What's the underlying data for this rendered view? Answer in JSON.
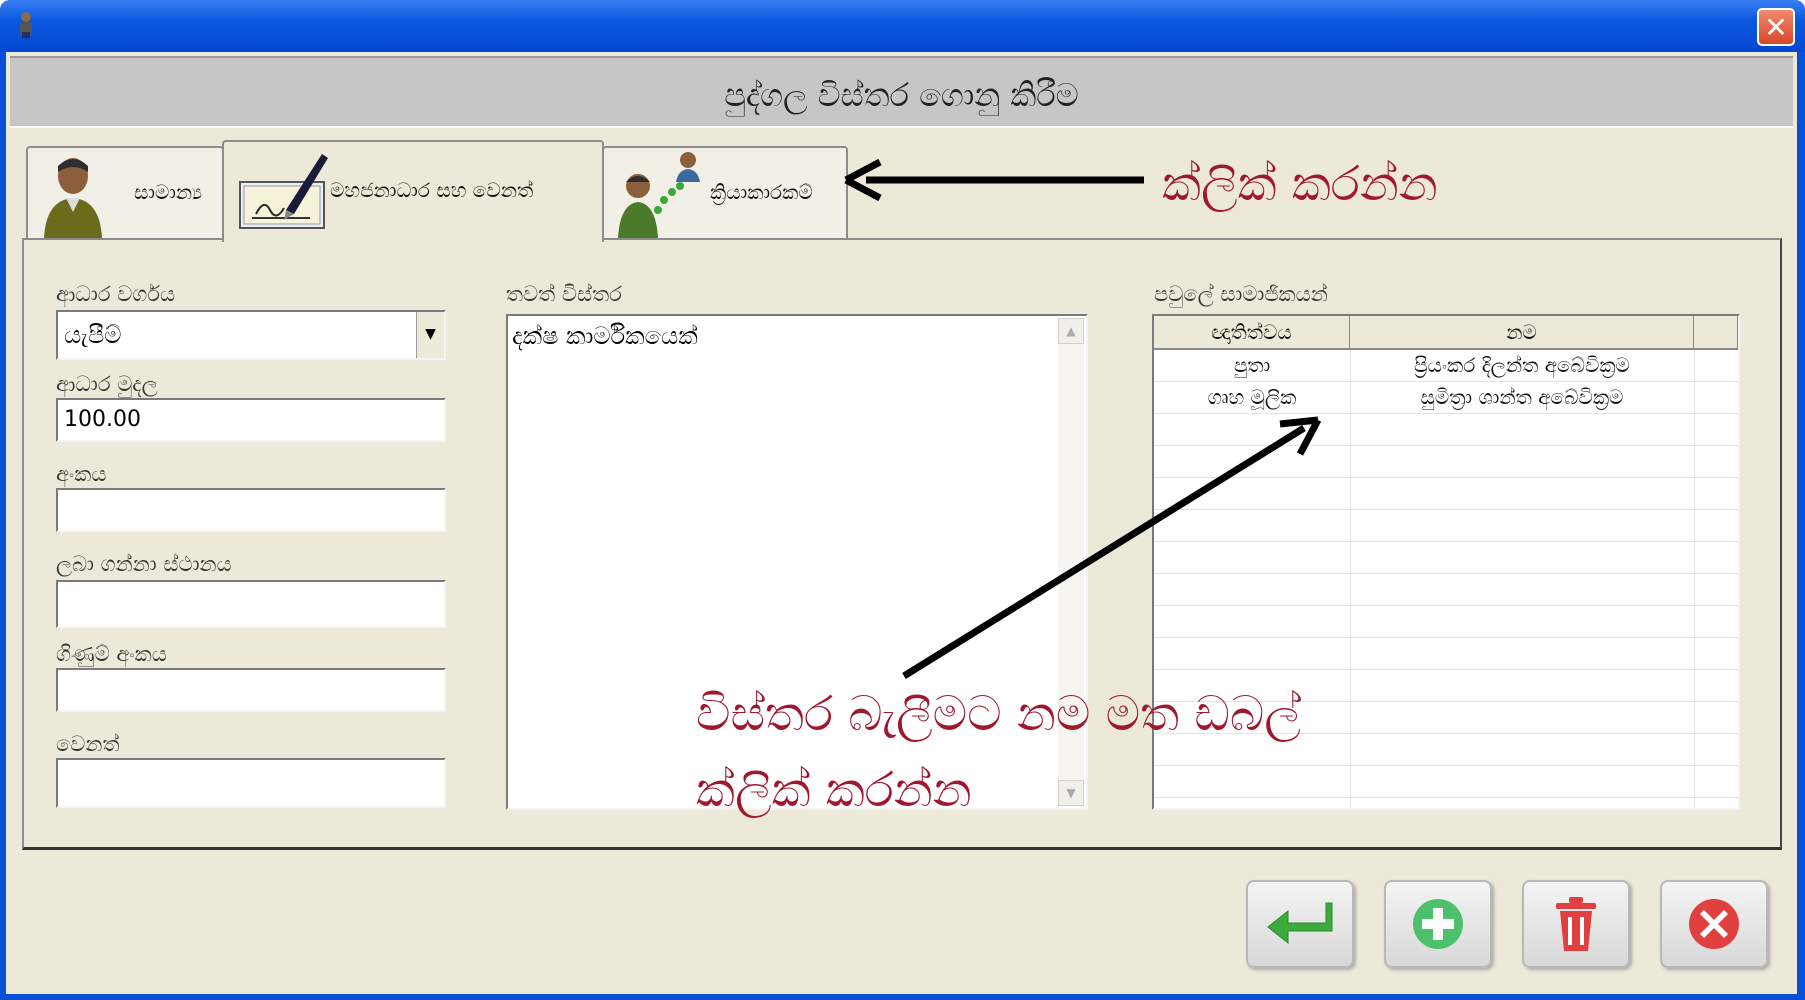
{
  "window": {
    "header_title": "පුද්ගල විස්තර ගොනු කිරීම",
    "close_glyph": "✕"
  },
  "tabs": [
    {
      "label": "සාමාන්‍ය",
      "icon": "person-icon"
    },
    {
      "label": "මහජනාධාර සහ වෙනත්",
      "icon": "signature-pen-icon",
      "active": true
    },
    {
      "label": "ක්‍රියාකාරකම්",
      "icon": "people-network-icon"
    }
  ],
  "form": {
    "aid_type_label": "ආධාර වර්ගය",
    "aid_type_value": "යැපීම්",
    "aid_amount_label": "ආධාර මුදල",
    "aid_amount_value": "100.00",
    "number_label": "අංකය",
    "number_value": "",
    "receiving_place_label": "ලබා ගන්නා ස්ථානය",
    "receiving_place_value": "",
    "account_number_label": "ගිණුම් අංකය",
    "account_number_value": "",
    "other_label": "වෙනත්",
    "other_value": ""
  },
  "more_details": {
    "label": "තවත් විස්තර",
    "text": "දක්ෂ කාර්මිකයෙක්"
  },
  "family": {
    "label": "පවුලේ සාමාජිකයන්",
    "columns": [
      "ඥාතිත්වය",
      "නම"
    ],
    "rows": [
      {
        "relation": "පුතා",
        "name": "ප්‍රියංකර දිලන්ත අබේවික්‍රම"
      },
      {
        "relation": "ගෘහ මූලික",
        "name": "සුමිත්‍රා ශාන්ත අබේවික්‍රම"
      }
    ]
  },
  "annotations": {
    "tab_hint": "ක්ලික් කරන්න",
    "grid_hint_line1": "විස්තර බැලීමට නම මත ඩබල්",
    "grid_hint_line2": "ක්ලික් කරන්න",
    "color": "#a01830"
  },
  "buttons": [
    {
      "name": "enter-button",
      "icon": "enter-arrow-icon",
      "color": "#3daa3d"
    },
    {
      "name": "add-button",
      "icon": "plus-circle-icon",
      "color": "#4cc06a"
    },
    {
      "name": "delete-button",
      "icon": "trash-icon",
      "color": "#e04040"
    },
    {
      "name": "cancel-button",
      "icon": "x-circle-icon",
      "color": "#e04040"
    }
  ]
}
